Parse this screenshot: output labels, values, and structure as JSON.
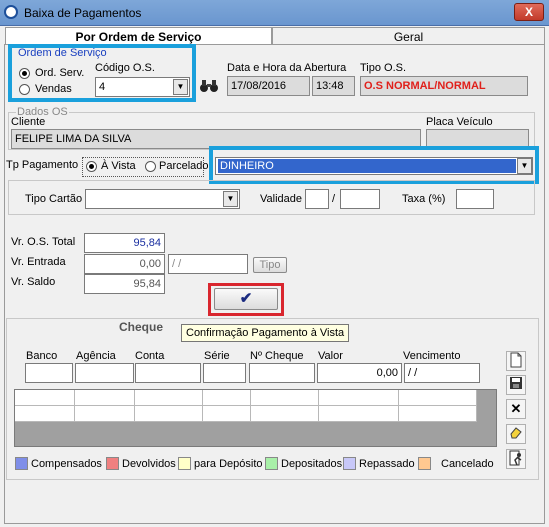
{
  "window": {
    "title": "Baixa de Pagamentos",
    "close_label": "X"
  },
  "tabs": [
    {
      "label": "Por Ordem de Serviço",
      "active": true
    },
    {
      "label": "Geral",
      "active": false
    }
  ],
  "ordem": {
    "group_label": "Ordem de Serviço",
    "opt_ord_serv": "Ord. Serv.",
    "opt_vendas": "Vendas",
    "selected": "Ord. Serv.",
    "codigo_label": "Código O.S.",
    "codigo_value": "4"
  },
  "abertura": {
    "label": "Data e Hora da Abertura",
    "date": "17/08/2016",
    "time": "13:48"
  },
  "tipo_os": {
    "label": "Tipo O.S.",
    "value": "O.S NORMAL/NORMAL",
    "color": "#e0201b"
  },
  "dados_os": {
    "group_label": "Dados OS",
    "cliente_label": "Cliente",
    "cliente_value": "FELIPE LIMA DA SILVA",
    "placa_label": "Placa Veículo",
    "placa_value": ""
  },
  "pagamento": {
    "tp_label": "Tp Pagamento",
    "opt_avista": "À Vista",
    "opt_parcelado": "Parcelado",
    "selected": "À Vista",
    "forma_value": "DINHEIRO"
  },
  "cartao": {
    "tipo_label": "Tipo Cartão",
    "validade_label": "Validade",
    "validade_sep": "/",
    "taxa_label": "Taxa (%)"
  },
  "valores": {
    "total_label": "Vr. O.S. Total",
    "total_value": "95,84",
    "entrada_label": "Vr. Entrada",
    "entrada_value": "0,00",
    "entrada_date": " / /",
    "tipo_button": "Tipo",
    "saldo_label": "Vr. Saldo",
    "saldo_value": "95,84"
  },
  "confirm": {
    "icon": "✔",
    "tooltip": "Confirmação Pagamento à Vista"
  },
  "cheque": {
    "title": "Cheque",
    "cols": [
      "Banco",
      "Agência",
      "Conta",
      "Série",
      "Nº Cheque",
      "Valor",
      "Vencimento"
    ],
    "valor_value": "0,00",
    "vencimento_value": " / /"
  },
  "legend": [
    {
      "label": "Compensados",
      "color": "#7f8ee8"
    },
    {
      "label": "Devolvidos",
      "color": "#f08080"
    },
    {
      "label": "para Depósito",
      "color": "#ffffc8"
    },
    {
      "label": "Depositados",
      "color": "#a8f0a8"
    },
    {
      "label": "Repassado",
      "color": "#c8c8f8"
    },
    {
      "label": "Cancelado",
      "color": "#ffc890"
    }
  ]
}
